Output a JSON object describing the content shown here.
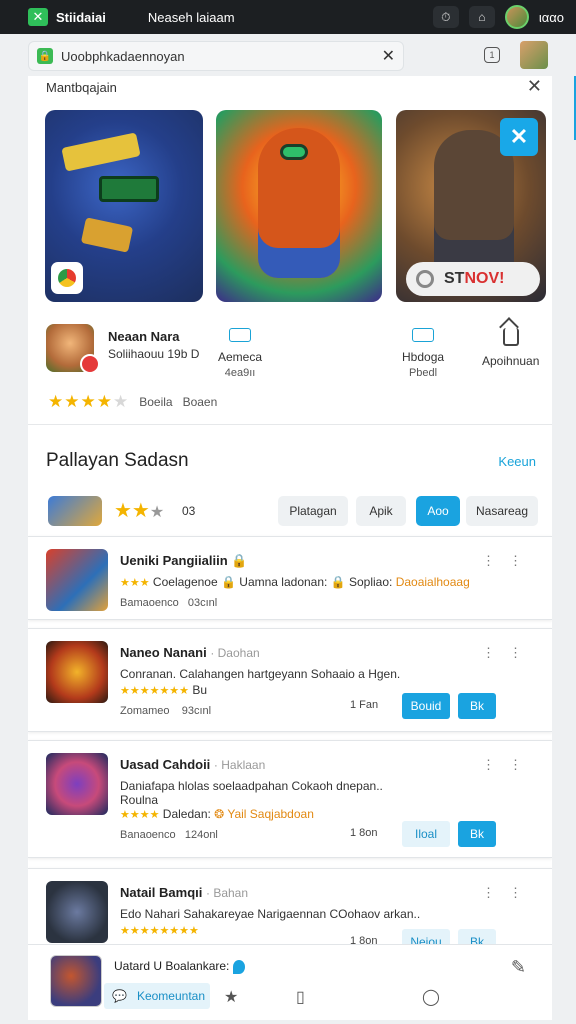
{
  "status": {
    "app_name": "Stiidaiai",
    "title": "Neaseh laiaam",
    "time": "ιααο",
    "icon_left": "⏱",
    "icon_home": "⌂"
  },
  "url": {
    "text": "Uoobphkadaennoyan",
    "close": "✕",
    "lock": "🔒"
  },
  "top": {
    "label": "Mantbqajain",
    "close": "✕"
  },
  "hero": {
    "store_button": "ST",
    "store_button_red": "NOV!",
    "corner": "✕"
  },
  "developer": {
    "name": "Neaan Nara",
    "sub": "Soliihaouu 19b D",
    "col1": {
      "label": "Aemeca",
      "value": "4ea9ıı"
    },
    "col2": {
      "label": "Hbdoga",
      "value": "Pbedl"
    },
    "col3": {
      "label": "Apoihnuan"
    },
    "rating_stars": "★★★★",
    "rating_half": "★",
    "rating_a": "Boeila",
    "rating_b": "Boaen"
  },
  "section": {
    "title": "Pallayan Sadasn",
    "see_all": "Keeun",
    "filter_stars_on": "★★",
    "filter_stars_off": "★",
    "filter_num": "03",
    "chips": [
      "Platagan",
      "Apik",
      "Aoo",
      "Nasareag"
    ]
  },
  "apps": [
    {
      "title": "Ueniki Pangiialiin",
      "sub": "",
      "line1_stars": "★★★",
      "line1_text": " Coelagenoe",
      "line1_rest": " Uamna ladonan:",
      "line1_more": " Sopliao:",
      "line1_org": " Daoaialhoaag",
      "foot_a": "Bamaoenco",
      "foot_b": "03cınl"
    },
    {
      "title": "Naneo Nanani",
      "sub": "· Daohan",
      "line1": "Conranan. Calahangen hartgeyann Sohaaio a Hgen.",
      "line2_stars": "★★★★★★★",
      "line2_text": " Bu",
      "foot_a": "Zomameo",
      "foot_b": "93cınl",
      "size": "1 Fan",
      "btn1": "Bouid",
      "btn2": "Bk"
    },
    {
      "title": "Uasad Cahdoii",
      "sub": "· Haklaan",
      "line1": "Daniafapa hlolas soelaadpahan Cokaoh dnepan..",
      "line2": "Roulna",
      "line3_stars": "★★★★",
      "line3_text": " Daledan:",
      "line3_org": " Yail Saqjabdoan",
      "foot_a": "Banaoenco",
      "foot_b": "124onl",
      "size": "1 8on",
      "btn1": "Iloal",
      "btn2": "Bk"
    },
    {
      "title": "Natail Bamqıi",
      "sub": "· Bahan",
      "line1": "Edo Nahari Sahakareyae Narigaennan COohaov arkan..",
      "line2_stars": "★★★★★★★★",
      "line2_text": "",
      "size": "1 8on",
      "btn1": "Neiou",
      "btn2": "Bk"
    }
  ],
  "bottom": {
    "text": "Uatard U Boalankare:",
    "button": "Keomeuntan",
    "edit": "✎"
  }
}
